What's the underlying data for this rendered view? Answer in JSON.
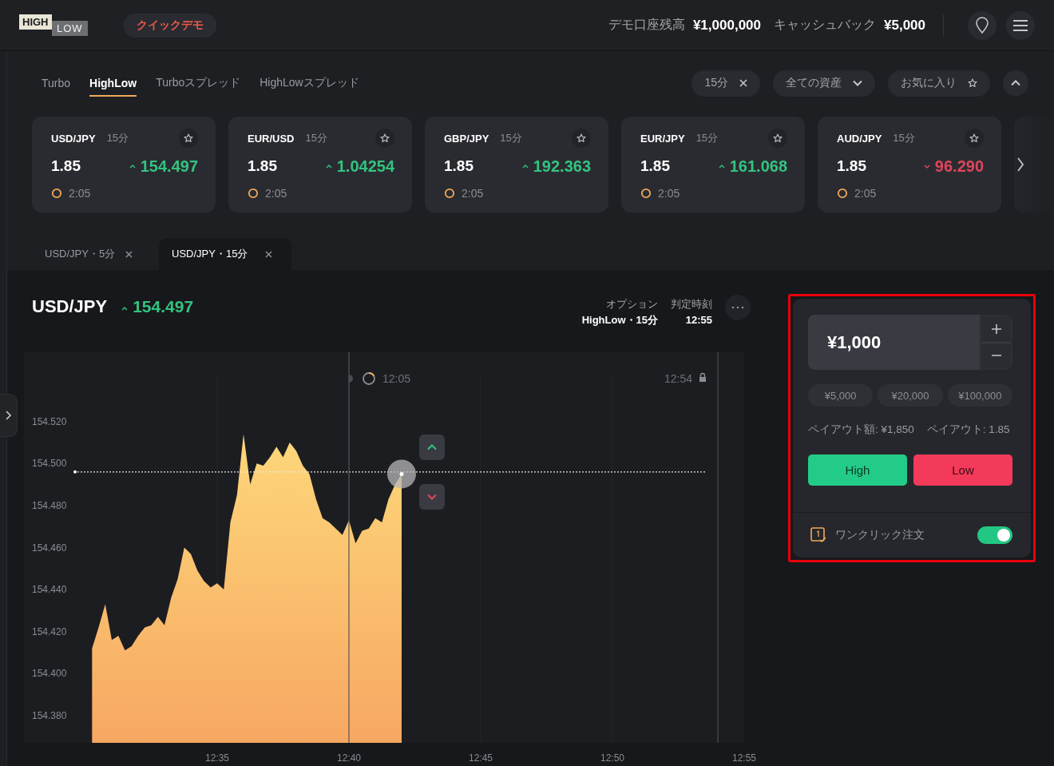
{
  "header": {
    "logo": [
      "HIGH",
      "LOW"
    ],
    "demo_badge": "クイックデモ",
    "balance_label": "デモ口座残高",
    "balance": "¥1,000,000",
    "cashback_label": "キャッシュバック",
    "cashback": "¥5,000"
  },
  "option_tabs": [
    {
      "label": "Turbo",
      "selected": false
    },
    {
      "label": "HighLow",
      "selected": true
    },
    {
      "label": "Turboスプレッド",
      "selected": false
    },
    {
      "label": "HighLowスプレッド",
      "selected": false
    }
  ],
  "filters": [
    {
      "kind": "chip-close",
      "label": "15分"
    },
    {
      "kind": "dropdown",
      "label": "全ての資産"
    },
    {
      "kind": "favorite",
      "label": "お気に入り"
    }
  ],
  "asset_cards": [
    {
      "pair": "USD/JPY",
      "duration": "15分",
      "payout": "1.85",
      "rising": true,
      "price": "154.497",
      "time": "2:05"
    },
    {
      "pair": "EUR/USD",
      "duration": "15分",
      "payout": "1.85",
      "rising": true,
      "price": "1.04254",
      "time": "2:05"
    },
    {
      "pair": "GBP/JPY",
      "duration": "15分",
      "payout": "1.85",
      "rising": true,
      "price": "192.363",
      "time": "2:05"
    },
    {
      "pair": "EUR/JPY",
      "duration": "15分",
      "payout": "1.85",
      "rising": true,
      "price": "161.068",
      "time": "2:05"
    },
    {
      "pair": "AUD/JPY",
      "duration": "15分",
      "payout": "1.85",
      "rising": false,
      "price": "96.290",
      "time": "2:05"
    }
  ],
  "chart_tabs": [
    {
      "label": "USD/JPY・5分",
      "selected": false
    },
    {
      "label": "USD/JPY・15分",
      "selected": true
    }
  ],
  "chart_panel": {
    "pair": "USD/JPY",
    "rising": true,
    "price": "154.497",
    "countdown": "12:05",
    "closing_time": "12:54",
    "option_label": "オプション",
    "option_value": "HighLow・15分",
    "expiry_label": "判定時刻",
    "expiry_value": "12:55",
    "chart_data": {
      "type": "area",
      "ylim": [
        154.367,
        154.553
      ],
      "categories": [
        null,
        null,
        null,
        null,
        null,
        null,
        null,
        null,
        null,
        null,
        null,
        null,
        null,
        null,
        null,
        null,
        null,
        null,
        null,
        null,
        "12:35",
        null,
        null,
        null,
        null,
        null,
        null,
        null,
        null,
        null,
        null,
        null,
        null,
        null,
        null,
        null,
        null,
        null,
        null,
        null,
        "12:40",
        null,
        null,
        null,
        null,
        null,
        null,
        null,
        null,
        null,
        null,
        null,
        null,
        null,
        null,
        null,
        null,
        null,
        null,
        null,
        "12:45",
        null,
        null,
        null,
        null,
        null,
        null,
        null,
        null,
        null,
        null,
        null,
        null,
        null,
        null,
        null,
        null,
        null,
        null,
        null,
        "12:50",
        null,
        null,
        null,
        null,
        null,
        null,
        null,
        null,
        null,
        null,
        null,
        null,
        null,
        null,
        null,
        null,
        null,
        null,
        null,
        "12:55"
      ],
      "yticks": [
        {
          "value": 154.38,
          "label": "154.380"
        },
        {
          "value": 154.4,
          "label": "154.400"
        },
        {
          "value": 154.42,
          "label": "154.420"
        },
        {
          "value": 154.44,
          "label": "154.440"
        },
        {
          "value": 154.46,
          "label": "154.460"
        },
        {
          "value": 154.48,
          "label": "154.480"
        },
        {
          "value": 154.5,
          "label": "154.500"
        },
        {
          "value": 154.52,
          "label": "154.520"
        }
      ],
      "series": [
        {
          "color": "#fdd77a",
          "values": [
            null,
            154.412,
            154.422,
            154.433,
            154.416,
            154.418,
            154.411,
            154.413,
            154.418,
            154.422,
            154.423,
            154.427,
            154.423,
            154.436,
            154.445,
            154.46,
            154.457,
            154.449,
            154.444,
            154.441,
            154.443,
            154.44,
            154.472,
            154.485,
            154.514,
            154.49,
            154.5,
            154.499,
            154.503,
            154.508,
            154.503,
            154.51,
            154.506,
            154.499,
            154.495,
            154.483,
            154.474,
            154.472,
            154.469,
            154.466,
            154.473,
            154.462,
            154.468,
            154.469,
            154.474,
            154.472,
            154.483,
            154.49,
            154.495,
            null,
            null,
            null,
            null,
            null,
            null,
            null,
            null,
            null,
            null,
            null,
            null,
            null,
            null,
            null,
            null,
            null,
            null,
            null,
            null,
            null,
            null,
            null,
            null,
            null,
            null,
            null,
            null,
            null,
            null,
            null,
            null,
            null,
            null,
            null,
            null,
            null,
            null,
            null,
            null,
            null,
            null,
            null,
            null,
            null,
            null,
            null,
            null,
            null,
            null,
            null,
            null
          ]
        }
      ],
      "ref_lines": [
        {
          "axis": "y",
          "value": 154.496
        },
        {
          "axis": "x",
          "value": "12:40"
        }
      ]
    }
  },
  "trade_panel": {
    "amount": "¥1,000",
    "presets": [
      "¥5,000",
      "¥20,000",
      "¥100,000"
    ],
    "payout_amount": "ペイアウト額: ¥1,850",
    "payout_rate": "ペイアウト: 1.85",
    "buttons": [
      {
        "kind": "high",
        "label": "High"
      },
      {
        "kind": "low",
        "label": "Low"
      }
    ],
    "one_click": {
      "label": "ワンクリック注文",
      "on": true
    }
  }
}
